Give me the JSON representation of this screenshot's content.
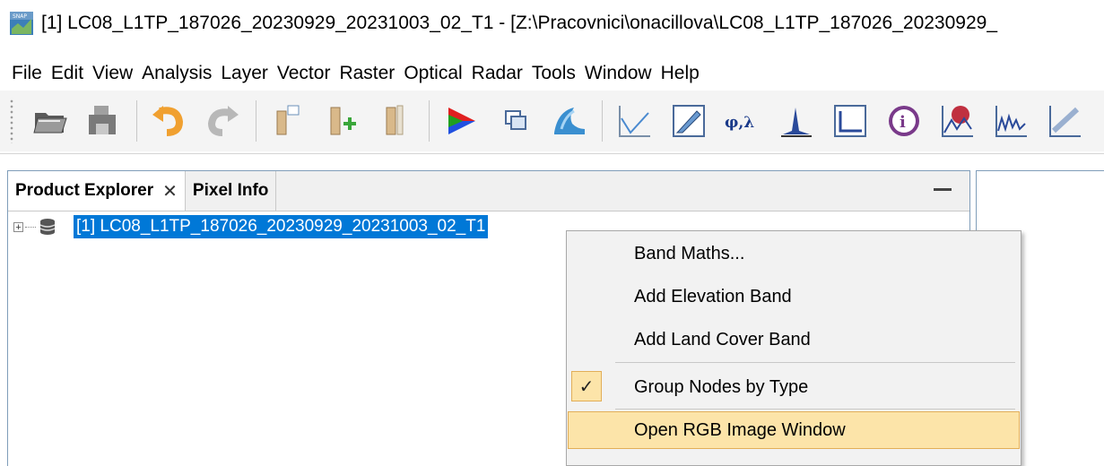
{
  "window": {
    "title": "[1] LC08_L1TP_187026_20230929_20231003_02_T1 - [Z:\\Pracovnici\\onacillova\\LC08_L1TP_187026_20230929_"
  },
  "menubar": {
    "items": [
      "File",
      "Edit",
      "View",
      "Analysis",
      "Layer",
      "Vector",
      "Raster",
      "Optical",
      "Radar",
      "Tools",
      "Window",
      "Help"
    ]
  },
  "toolbar": {
    "buttons": [
      "open-product-icon",
      "save-product-icon",
      "undo-icon",
      "redo-icon",
      "new-band-icon",
      "import-band-icon",
      "export-band-icon",
      "rgb-image-icon",
      "windows-icon",
      "wave-icon",
      "profile-plot-icon",
      "edit-icon",
      "geocoding-icon",
      "histogram-icon",
      "scatter-icon",
      "info-icon",
      "spectrum-view-icon",
      "time-series-icon",
      "scatter-plot-icon"
    ],
    "geocoding_label": "φ,λ"
  },
  "panel": {
    "tabs": [
      {
        "label": "Product Explorer",
        "active": true,
        "closable": true
      },
      {
        "label": "Pixel Info",
        "active": false,
        "closable": false
      }
    ],
    "close_glyph": "✕",
    "tree": {
      "expander": "+",
      "node_label": "[1] LC08_L1TP_187026_20230929_20231003_02_T1",
      "selected": true
    }
  },
  "context_menu": {
    "items": [
      {
        "label": "Band Maths..."
      },
      {
        "label": "Add Elevation Band"
      },
      {
        "label": "Add Land Cover Band"
      },
      {
        "label": "Group Nodes by Type",
        "checked": true,
        "check_glyph": "✓"
      },
      {
        "label": "Open RGB Image Window",
        "hover": true
      }
    ]
  },
  "colors": {
    "selection": "#0078d7",
    "menu_hover": "#fce4a9",
    "menu_hover_border": "#e2ae58"
  }
}
